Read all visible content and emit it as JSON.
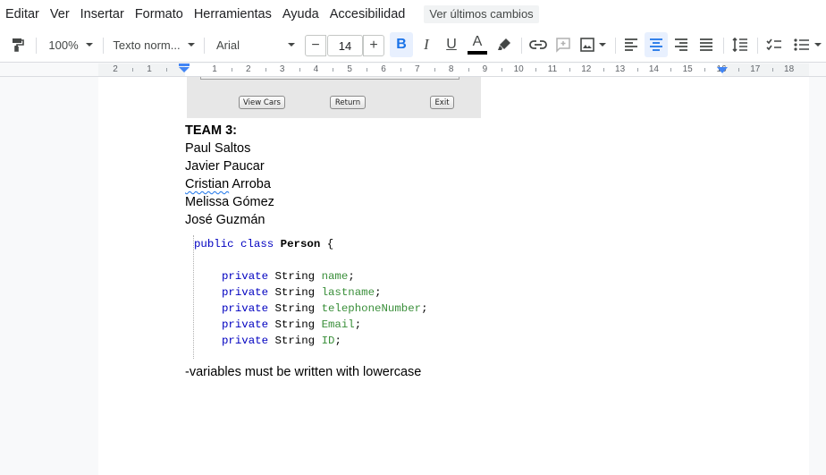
{
  "menu": {
    "items": [
      "Editar",
      "Ver",
      "Insertar",
      "Formato",
      "Herramientas",
      "Ayuda",
      "Accesibilidad"
    ],
    "changes_button": "Ver últimos cambios"
  },
  "toolbar": {
    "zoom": "100%",
    "style": "Texto norm...",
    "font": "Arial",
    "font_size": "14",
    "minus": "−",
    "plus": "+",
    "bold": "B",
    "italic": "I",
    "underline": "U",
    "text_color": "A",
    "text_color_value": "#000000"
  },
  "ruler": {
    "numbers": [
      "2",
      "1",
      "1",
      "2",
      "3",
      "4",
      "5",
      "6",
      "7",
      "8",
      "9",
      "10",
      "11",
      "12",
      "13",
      "14",
      "15",
      "16",
      "17",
      "18"
    ]
  },
  "document": {
    "image_buttons": [
      "View Cars",
      "Return",
      "Exit"
    ],
    "team_heading": "TEAM 3:",
    "members": [
      "Paul Saltos",
      "Javier Paucar",
      "Arroba",
      "Melissa Gómez",
      "José Guzmán"
    ],
    "misspelled_word": "Cristian",
    "code": {
      "line1": {
        "kw": "public class ",
        "name": "Person",
        "rest": " {"
      },
      "fields": [
        {
          "kw": "private ",
          "type": "String ",
          "name": "name",
          "end": ";"
        },
        {
          "kw": "private ",
          "type": "String ",
          "name": "lastname",
          "end": ";"
        },
        {
          "kw": "private ",
          "type": "String ",
          "name": "telephoneNumber",
          "end": ";"
        },
        {
          "kw": "private ",
          "type": "String ",
          "name": "Email",
          "end": ";"
        },
        {
          "kw": "private ",
          "type": "String ",
          "name": "ID",
          "end": ";"
        }
      ]
    },
    "note": "-variables must be written with lowercase"
  }
}
